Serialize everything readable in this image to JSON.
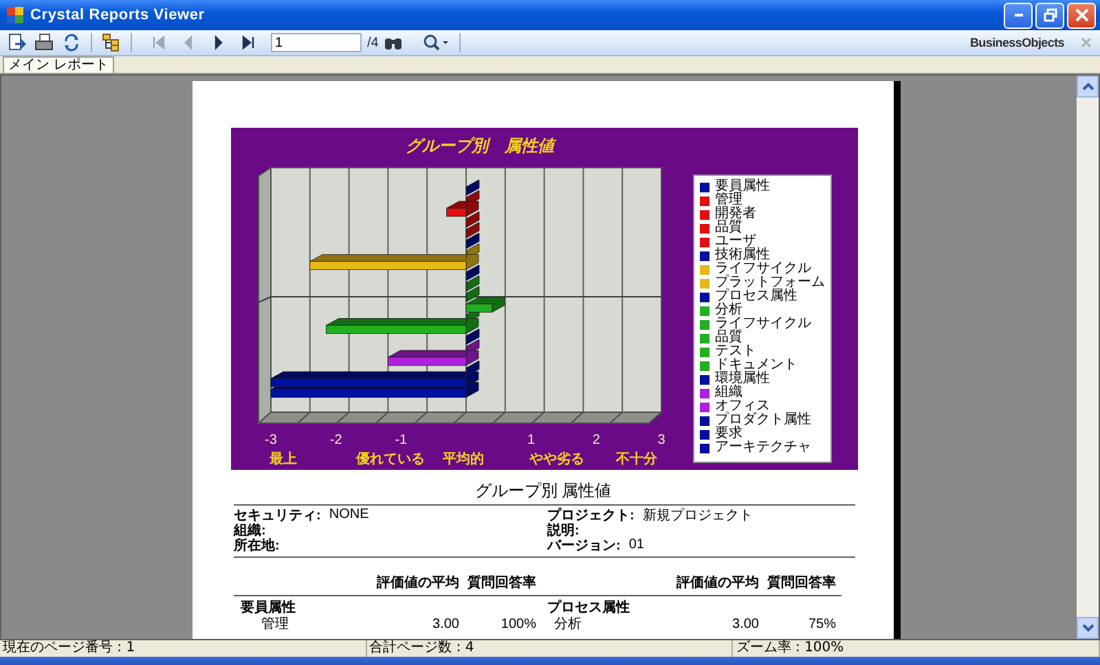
{
  "window": {
    "title": "Crystal Reports Viewer"
  },
  "toolbar": {
    "nav": [
      {
        "kind": "first",
        "disabled": true
      },
      {
        "kind": "prev",
        "disabled": true
      },
      {
        "kind": "next",
        "disabled": false
      },
      {
        "kind": "last",
        "disabled": false
      }
    ],
    "page_input": "1",
    "page_total": "/4",
    "brand": "BusinessObjects"
  },
  "tabs": [
    {
      "label": "メイン レポート",
      "selected": true
    }
  ],
  "report": {
    "chart": {
      "chart_data": {
        "type": "bar",
        "orientation": "horizontal",
        "title": "グループ別　属性値",
        "legend": "right",
        "xlim": [
          -3,
          3
        ],
        "xticks": [
          -3,
          -2,
          -1,
          1,
          2,
          3
        ],
        "series": [
          {
            "name": "要員属性",
            "color": "#0010a0",
            "values": [
              0
            ]
          },
          {
            "name": "管理",
            "color": "#e01010",
            "values": [
              0
            ]
          },
          {
            "name": "開発者",
            "color": "#e01010",
            "values": [
              -0.3
            ]
          },
          {
            "name": "品質",
            "color": "#e01010",
            "values": [
              0
            ]
          },
          {
            "name": "ユーザ",
            "color": "#e01010",
            "values": [
              0
            ]
          },
          {
            "name": "技術属性",
            "color": "#0010a0",
            "values": [
              0
            ]
          },
          {
            "name": "ライフサイクル",
            "color": "#e8b818",
            "values": [
              0
            ]
          },
          {
            "name": "プラットフォーム",
            "color": "#e8b818",
            "values": [
              -2.4
            ]
          },
          {
            "name": "プロセス属性",
            "color": "#0010a0",
            "values": [
              0
            ]
          },
          {
            "name": "分析",
            "color": "#20b020",
            "values": [
              0
            ]
          },
          {
            "name": "ライフサイクル",
            "color": "#20b020",
            "values": [
              0
            ]
          },
          {
            "name": "品質",
            "color": "#20b020",
            "values": [
              0.4
            ]
          },
          {
            "name": "テスト",
            "color": "#20b020",
            "values": [
              0
            ]
          },
          {
            "name": "ドキュメント",
            "color": "#20b020",
            "values": [
              -2.15
            ]
          },
          {
            "name": "環境属性",
            "color": "#0010a0",
            "values": [
              0
            ]
          },
          {
            "name": "組織",
            "color": "#b020e0",
            "values": [
              0
            ]
          },
          {
            "name": "オフィス",
            "color": "#b020e0",
            "values": [
              -1.2
            ]
          },
          {
            "name": "プロダクト属性",
            "color": "#0010a0",
            "values": [
              0
            ]
          },
          {
            "name": "要求",
            "color": "#0010a0",
            "values": [
              -3
            ]
          },
          {
            "name": "アーキテクチャ",
            "color": "#0010a0",
            "values": [
              -3
            ]
          }
        ]
      },
      "scale_labels": [
        "最上",
        "優れている",
        "平均的",
        "やや劣る",
        "不十分"
      ]
    },
    "title": "グループ別 属性値",
    "info_left": [
      {
        "label": "セキュリティ:",
        "value": "NONE"
      },
      {
        "label": "組織:"
      },
      {
        "label": "所在地:"
      }
    ],
    "info_right": [
      {
        "label": "プロジェクト:",
        "value": "新規プロジェクト"
      },
      {
        "label": "説明:"
      },
      {
        "label": "バージョン:",
        "value": "01"
      }
    ],
    "sections": [
      {
        "columns": [
          "評価値の平均",
          "質問回答率"
        ],
        "group": "要員属性",
        "rows": [
          {
            "name": "管理",
            "average": "3.00",
            "rate": "100%"
          }
        ]
      },
      {
        "columns": [
          "評価値の平均",
          "質問回答率"
        ],
        "group": "プロセス属性",
        "rows": [
          {
            "name": "分析",
            "average": "3.00",
            "rate": "75%"
          }
        ]
      }
    ]
  },
  "status_bar": [
    "現在のページ番号 : 1",
    "合計ページ数 : 4",
    "ズーム率 : 100%"
  ]
}
